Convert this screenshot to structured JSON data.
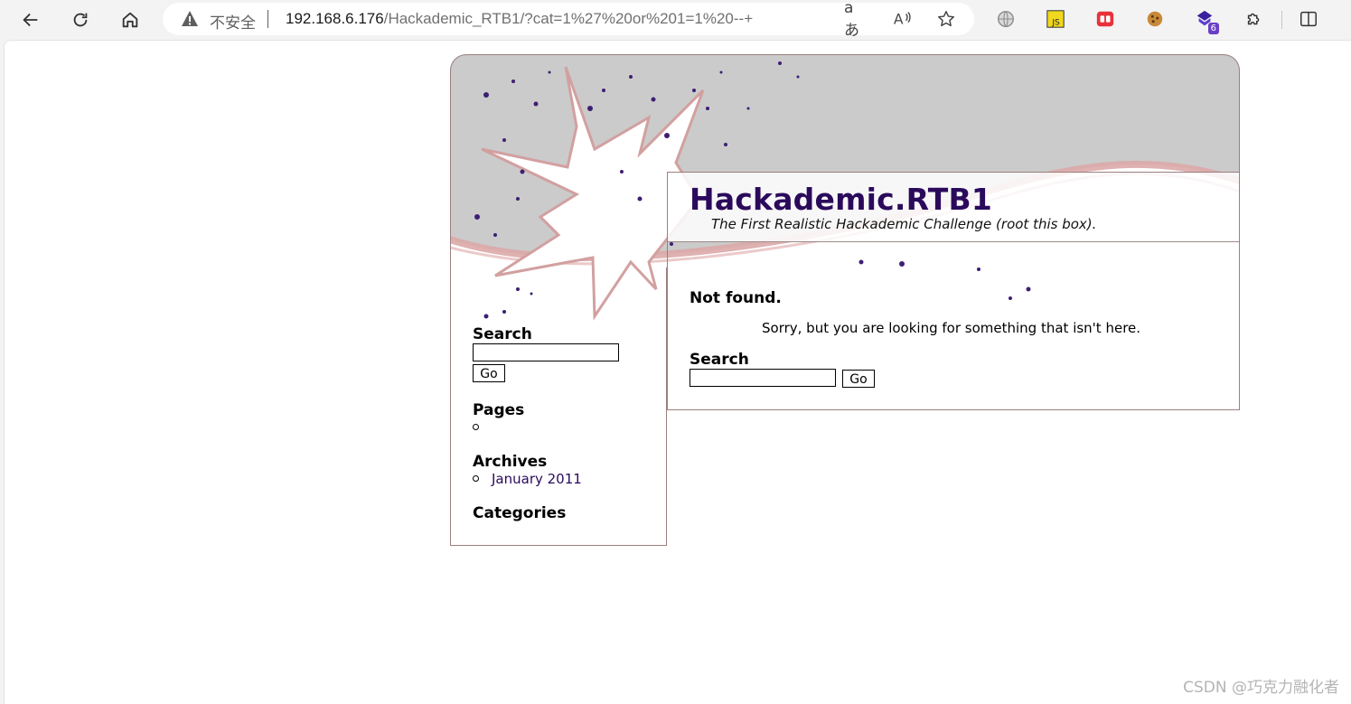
{
  "browser": {
    "security_label": "不安全",
    "url_host": "192.168.6.176",
    "url_path": "/Hackademic_RTB1/?cat=1%27%20or%201=1%20--+",
    "read_aloud_glyph": "aあ",
    "extension_badge": "6",
    "js_ext_label": "JS"
  },
  "site": {
    "title": "Hackademic.RTB1",
    "description": "The First Realistic Hackademic Challenge (root this box)."
  },
  "sidebar": {
    "search_heading": "Search",
    "go_label": "Go",
    "pages_heading": "Pages",
    "archives_heading": "Archives",
    "archives": [
      "January 2011"
    ],
    "categories_heading": "Categories"
  },
  "main": {
    "heading": "Not found.",
    "message": "Sorry, but you are looking for something that isn't here.",
    "search_heading": "Search",
    "go_label": "Go"
  },
  "watermark": "CSDN @巧克力融化者",
  "colors": {
    "title": "#2b0a5c",
    "border": "#9c7f7f",
    "header_gray": "#cbcbcb",
    "star_stroke": "#d2a0a0",
    "dots": "#3d1f73"
  }
}
